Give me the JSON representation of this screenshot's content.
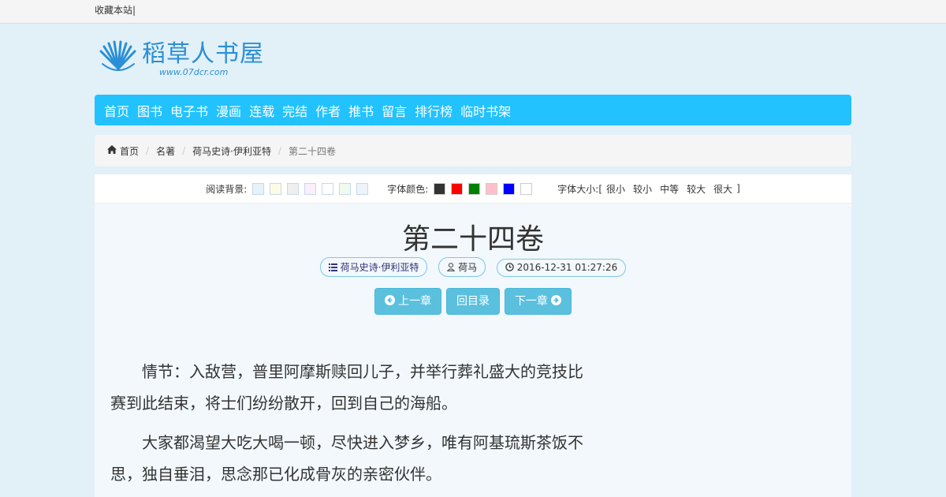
{
  "topbar": {
    "bookmark": "收藏本站|"
  },
  "logo": {
    "name": "稻草人书屋",
    "url": "www.07dcr.com"
  },
  "nav": [
    {
      "label": "首页"
    },
    {
      "label": "图书"
    },
    {
      "label": "电子书"
    },
    {
      "label": "漫画"
    },
    {
      "label": "连载"
    },
    {
      "label": "完结"
    },
    {
      "label": "作者"
    },
    {
      "label": "推书"
    },
    {
      "label": "留言"
    },
    {
      "label": "排行榜"
    },
    {
      "label": "临时书架"
    }
  ],
  "breadcrumb": {
    "home": "首页",
    "c1": "名著",
    "c2": "荷马史诗·伊利亚特",
    "current": "第二十四卷",
    "separator": "/"
  },
  "toolbar": {
    "bg_label": "阅读背景:",
    "bg_colors": [
      "#e6f2fb",
      "#fdfbe4",
      "#efefef",
      "#fceefc",
      "#ffffff",
      "#eefbee",
      "#eef3f9"
    ],
    "font_label": "字体颜色:",
    "font_colors": [
      "#333333",
      "#ff0000",
      "#008000",
      "#ffc0cb",
      "#0000ff",
      "#ffffff"
    ],
    "size_label": "字体大小:[",
    "sizes": [
      "很小",
      "较小",
      "中等",
      "较大",
      "很大"
    ],
    "size_end": "]"
  },
  "chapter": {
    "title": "第二十四卷",
    "book": "荷马史诗·伊利亚特",
    "author": "荷马",
    "date": "2016-12-31 01:27:26",
    "prev": "上一章",
    "toc": "回目录",
    "next": "下一章"
  },
  "paragraphs": [
    "情节：入敌营，普里阿摩斯赎回儿子，并举行葬礼盛大的竞技比赛到此结束，将士们纷纷散开，回到自己的海船。",
    "大家都渴望大吃大喝一顿，尽快进入梦乡，唯有阿基琉斯茶饭不思，独自垂泪，思念那已化成骨灰的亲密伙伴。"
  ]
}
